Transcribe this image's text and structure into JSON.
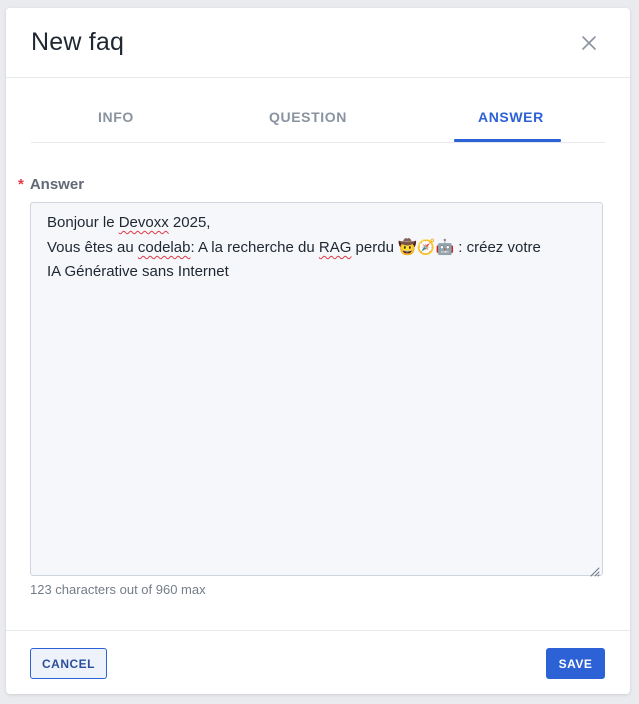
{
  "dialog": {
    "title": "New faq"
  },
  "tabs": [
    {
      "label": "INFO",
      "active": false
    },
    {
      "label": "QUESTION",
      "active": false
    },
    {
      "label": "ANSWER",
      "active": true
    }
  ],
  "answer_field": {
    "required_marker": "*",
    "label": "Answer",
    "value_lines": [
      {
        "parts": [
          "Bonjour le ",
          "Devoxx",
          " 2025,"
        ]
      },
      {
        "parts": [
          "Vous êtes au ",
          "codelab",
          ":  A la recherche du ",
          "RAG",
          " perdu ",
          "🤠🧭🤖",
          " : créez votre"
        ]
      },
      {
        "parts": [
          "IA Générative sans Internet"
        ]
      }
    ],
    "counter": "123 characters out of 960 max"
  },
  "footer": {
    "cancel_label": "CANCEL",
    "save_label": "SAVE"
  },
  "colors": {
    "accent": "#2c62d6",
    "required": "#e03a45"
  },
  "icons": {
    "close": "close-icon",
    "resize": "resize-handle-icon"
  }
}
